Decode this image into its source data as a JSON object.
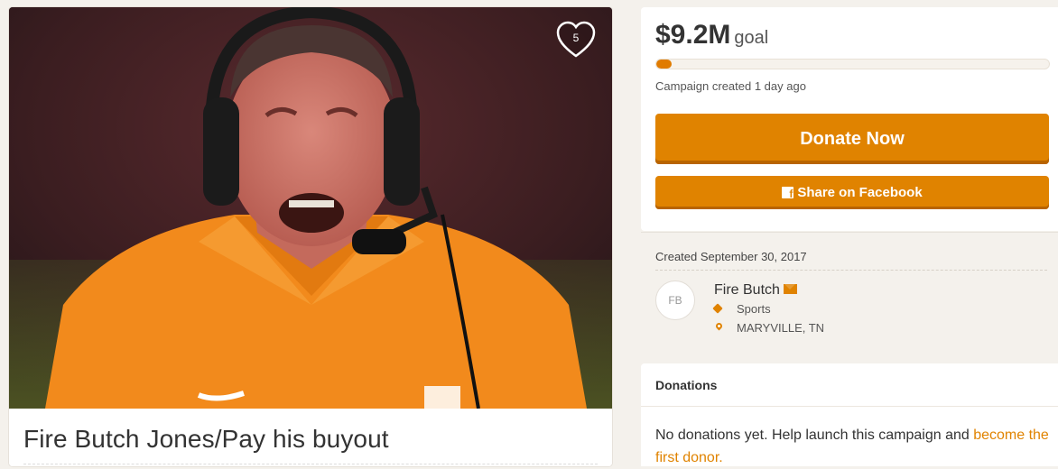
{
  "campaign": {
    "title": "Fire Butch Jones/Pay his buyout",
    "likes": "5"
  },
  "goal": {
    "amount": "$9.2M",
    "label": "goal",
    "progress_percent": 2,
    "created_ago": "Campaign created 1 day ago"
  },
  "actions": {
    "donate_label": "Donate Now",
    "share_label": "Share on Facebook"
  },
  "info": {
    "created_date": "Created September 30, 2017",
    "avatar_initials": "FB",
    "organizer": "Fire Butch",
    "category": "Sports",
    "location": "MARYVILLE, TN"
  },
  "donations": {
    "heading": "Donations",
    "empty_text": "No donations yet. Help launch this campaign and ",
    "empty_link": "become the first donor."
  },
  "colors": {
    "accent": "#e08300",
    "page_bg": "#f4f1ec"
  },
  "icons": {
    "heart": "heart-icon",
    "facebook": "facebook-icon",
    "mail": "mail-icon",
    "tag": "tag-icon",
    "pin": "map-pin-icon"
  }
}
